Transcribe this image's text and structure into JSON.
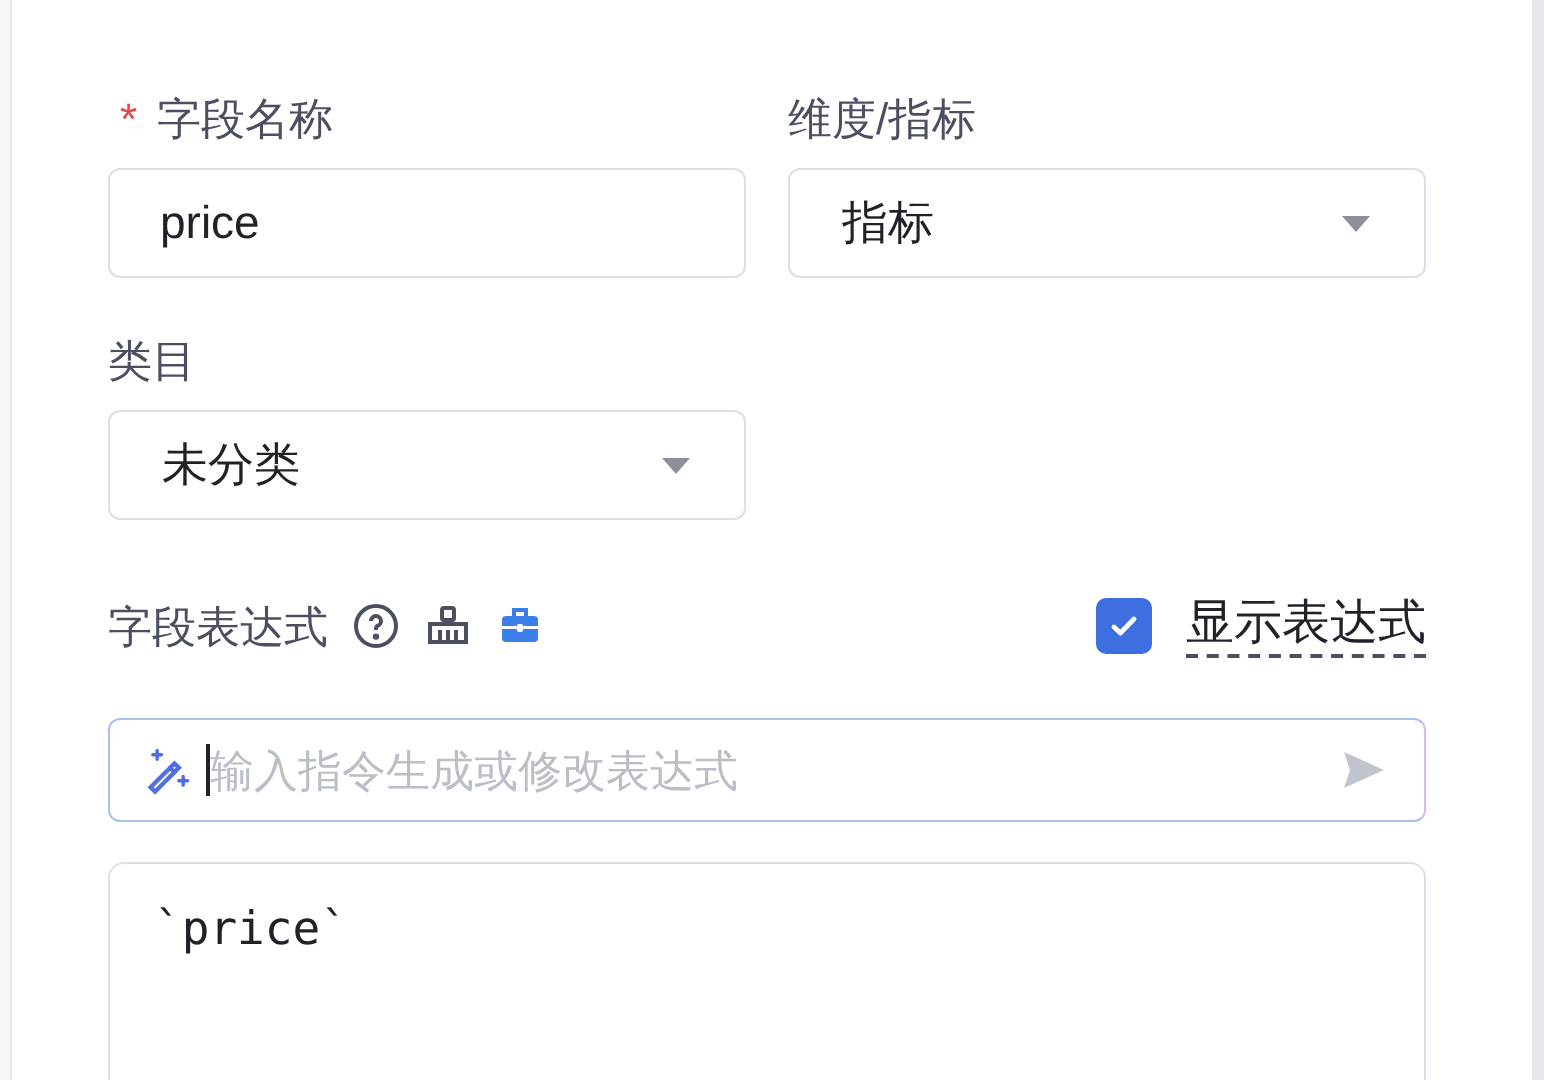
{
  "field_name": {
    "label": "字段名称",
    "required": true,
    "required_mark": "*",
    "value": "price"
  },
  "dimension": {
    "label": "维度/指标",
    "value": "指标"
  },
  "category": {
    "label": "类目",
    "value": "未分类"
  },
  "expression": {
    "label": "字段表达式",
    "show_expression": {
      "label": "显示表达式",
      "checked": true
    },
    "ai_input": {
      "placeholder": "输入指令生成或修改表达式"
    },
    "code": "`price`"
  }
}
